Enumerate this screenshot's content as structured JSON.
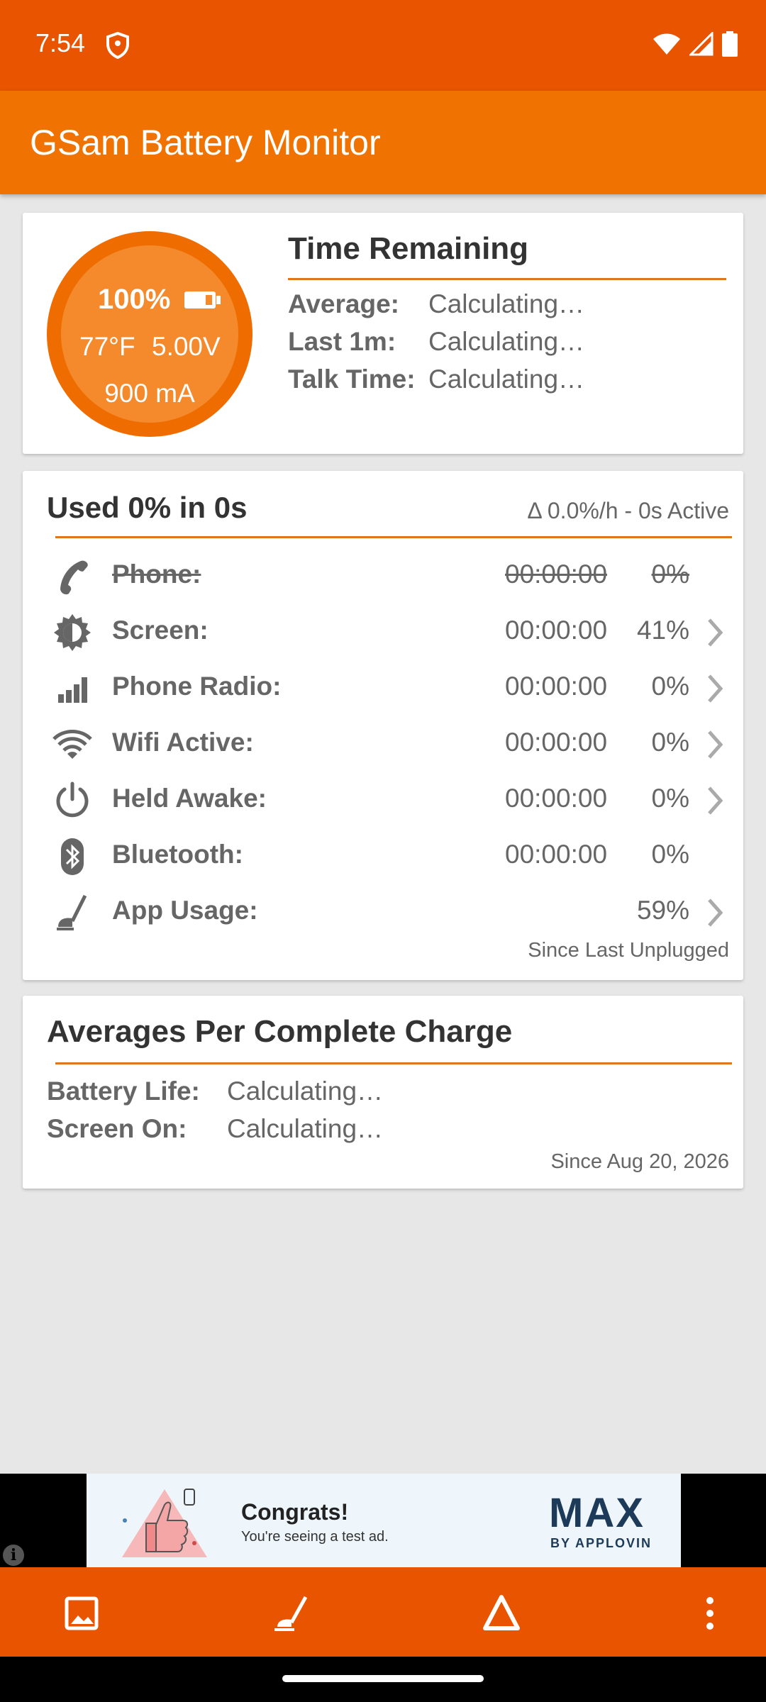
{
  "status_bar": {
    "time": "7:54",
    "icons": [
      "shield-icon",
      "wifi-icon",
      "signal-icon",
      "battery-icon"
    ]
  },
  "app_bar": {
    "title": "GSam Battery Monitor"
  },
  "colors": {
    "primary": "#f07200",
    "primary_dark": "#e85400",
    "accent_line": "#e0761a",
    "background": "#e7e7e7"
  },
  "battery_gauge": {
    "level": "100%",
    "temperature": "77°F",
    "voltage": "5.00V",
    "current": "900 mA",
    "fill_fraction": 1.0
  },
  "time_remaining": {
    "title": "Time Remaining",
    "rows": [
      {
        "label": "Average:",
        "value": "Calculating…"
      },
      {
        "label": "Last 1m:",
        "value": "Calculating…"
      },
      {
        "label": "Talk Time:",
        "value": "Calculating…"
      }
    ]
  },
  "usage": {
    "title": "Used 0% in 0s",
    "delta": "Δ 0.0%/h - 0s Active",
    "rows": [
      {
        "icon": "phone-icon",
        "label": "Phone:",
        "time": "00:00:00",
        "pct": "0%",
        "chevron": false,
        "struck": true
      },
      {
        "icon": "screen-brightness-icon",
        "label": "Screen:",
        "time": "00:00:00",
        "pct": "41%",
        "chevron": true,
        "struck": false
      },
      {
        "icon": "signal-bars-icon",
        "label": "Phone Radio:",
        "time": "00:00:00",
        "pct": "0%",
        "chevron": true,
        "struck": false
      },
      {
        "icon": "wifi-icon",
        "label": "Wifi Active:",
        "time": "00:00:00",
        "pct": "0%",
        "chevron": true,
        "struck": false
      },
      {
        "icon": "power-icon",
        "label": "Held Awake:",
        "time": "00:00:00",
        "pct": "0%",
        "chevron": true,
        "struck": false
      },
      {
        "icon": "bluetooth-icon",
        "label": "Bluetooth:",
        "time": "00:00:00",
        "pct": "0%",
        "chevron": false,
        "struck": false
      },
      {
        "icon": "app-usage-icon",
        "label": "App Usage:",
        "time": "",
        "pct": "59%",
        "chevron": true,
        "struck": false
      }
    ],
    "footer": "Since Last Unplugged"
  },
  "averages": {
    "title": "Averages Per Complete Charge",
    "rows": [
      {
        "label": "Battery Life:",
        "value": "Calculating…"
      },
      {
        "label": "Screen On:",
        "value": "Calculating…"
      }
    ],
    "footer": "Since Aug 20, 2026"
  },
  "ad": {
    "headline": "Congrats!",
    "subtext": "You're seeing a test ad.",
    "brand": "MAX",
    "brand_sub": "BY APPLOVIN",
    "info_glyph": "i"
  },
  "bottom_nav": [
    "image-icon",
    "app-usage-icon",
    "delta-icon",
    "more-vert-icon"
  ]
}
